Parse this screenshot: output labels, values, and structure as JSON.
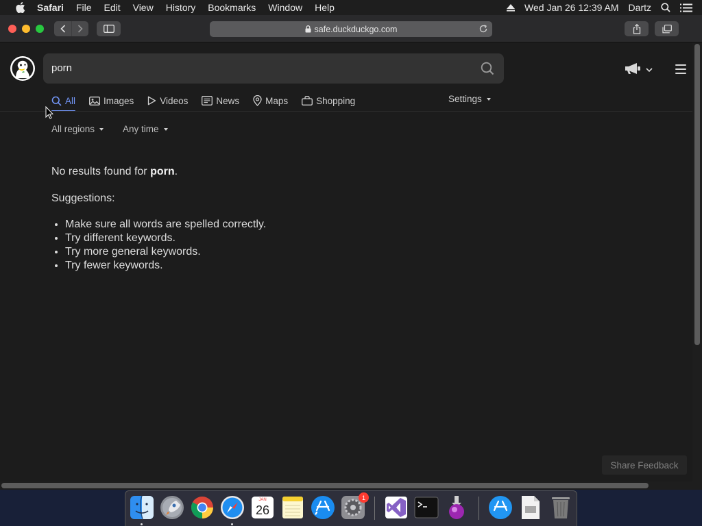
{
  "menubar": {
    "app_name": "Safari",
    "items": [
      "File",
      "Edit",
      "View",
      "History",
      "Bookmarks",
      "Window",
      "Help"
    ],
    "datetime": "Wed Jan 26  12:39 AM",
    "user": "Dartz"
  },
  "browser": {
    "url": "safe.duckduckgo.com"
  },
  "search": {
    "query": "porn"
  },
  "tabs": [
    {
      "label": "All",
      "icon": "search-icon",
      "active": true
    },
    {
      "label": "Images",
      "icon": "image-icon"
    },
    {
      "label": "Videos",
      "icon": "play-icon"
    },
    {
      "label": "News",
      "icon": "newspaper-icon"
    },
    {
      "label": "Maps",
      "icon": "map-pin-icon"
    },
    {
      "label": "Shopping",
      "icon": "shopping-bag-icon"
    }
  ],
  "settings_label": "Settings",
  "filters": {
    "region": "All regions",
    "time": "Any time"
  },
  "results": {
    "no_results_prefix": "No results found for ",
    "no_results_query": "porn",
    "no_results_suffix": ".",
    "suggestions_title": "Suggestions:",
    "suggestions": [
      "Make sure all words are spelled correctly.",
      "Try different keywords.",
      "Try more general keywords.",
      "Try fewer keywords."
    ]
  },
  "feedback_label": "Share Feedback",
  "dock": {
    "apps": [
      "finder-icon",
      "launchpad-icon",
      "chrome-icon",
      "safari-icon",
      "calendar-icon",
      "notes-icon",
      "app-store-icon",
      "system-preferences-icon",
      "visual-studio-icon",
      "terminal-icon",
      "installer-icon",
      "app-store-downloads-icon",
      "document-icon",
      "trash-icon"
    ],
    "calendar_month": "JAN",
    "calendar_day": "26",
    "badge_count": "1"
  },
  "colors": {
    "accent": "#7295f6",
    "background": "#1c1c1c",
    "search_box": "#333333"
  }
}
